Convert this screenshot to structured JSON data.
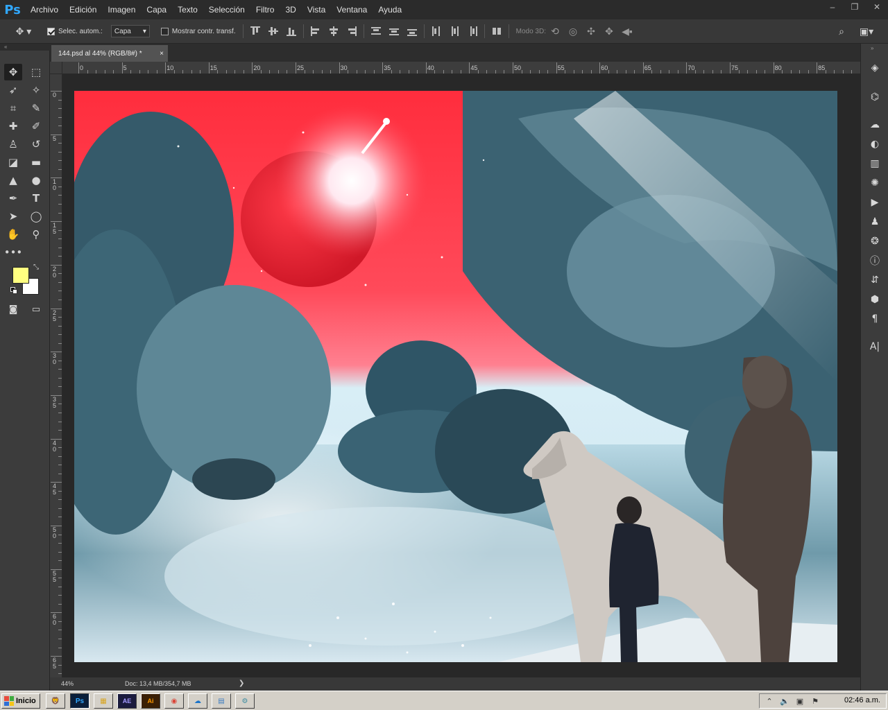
{
  "app": {
    "logo": "Ps",
    "menus": [
      "Archivo",
      "Edición",
      "Imagen",
      "Capa",
      "Texto",
      "Selección",
      "Filtro",
      "3D",
      "Vista",
      "Ventana",
      "Ayuda"
    ],
    "window_controls": [
      "–",
      "❐",
      "✕"
    ]
  },
  "options": {
    "auto_select_label": "Selec. autom.:",
    "auto_select_checked": true,
    "layer_select_value": "Capa",
    "show_transform_label": "Mostrar contr. transf.",
    "show_transform_checked": false,
    "mode3d_label": "Modo 3D:"
  },
  "document": {
    "tab_title": "144.psd al 44% (RGB/8#) *",
    "close_glyph": "×"
  },
  "rulers": {
    "horizontal": [
      "0",
      "5",
      "10",
      "15",
      "20",
      "25",
      "30",
      "35",
      "40",
      "45",
      "50",
      "55",
      "60",
      "65",
      "70",
      "75",
      "80",
      "85"
    ],
    "vertical": [
      "0",
      "5",
      "10",
      "15",
      "20",
      "25",
      "30",
      "35",
      "40",
      "45",
      "50",
      "55",
      "60",
      "65"
    ]
  },
  "colors": {
    "foreground": "#ffff80",
    "background": "#ffffff"
  },
  "status": {
    "zoom": "44%",
    "doc_info": "Doc: 13,4 MB/354,7 MB",
    "arrow": "❯"
  },
  "taskbar": {
    "start_label": "Inicio",
    "apps": [
      "Brave",
      "Ps",
      "Explorer",
      "AE",
      "Ai",
      "Chrome",
      "Cloud",
      "Notepad",
      "Settings"
    ],
    "clock": "02:46 a.m."
  }
}
